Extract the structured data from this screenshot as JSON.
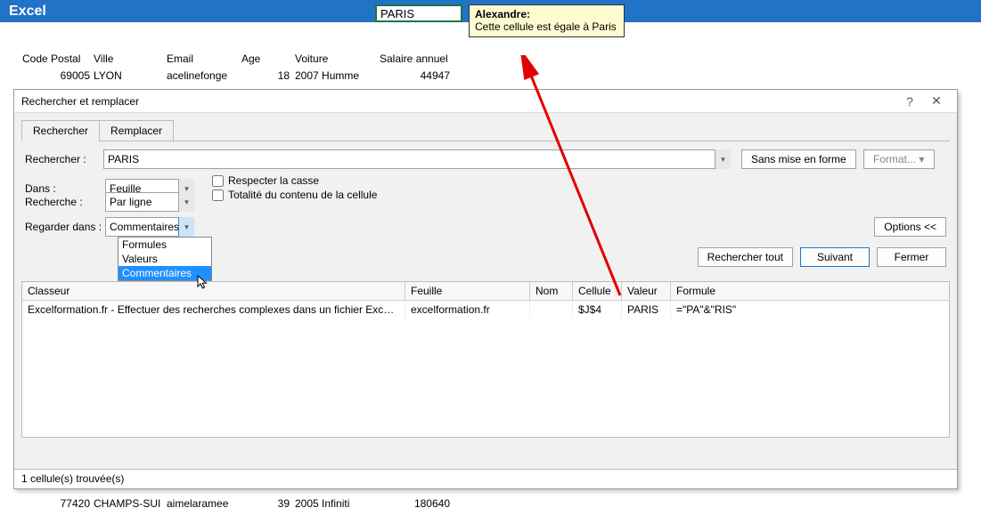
{
  "header": {
    "app": " Excel"
  },
  "cell": "PARIS",
  "comment": {
    "author": "Alexandre:",
    "text": "Cette cellule est égale à Paris"
  },
  "sheet": {
    "cols": [
      "Code Postal",
      "Ville",
      "Email",
      "Age",
      "Voiture",
      "Salaire annuel"
    ],
    "row1": {
      "cp": "69005",
      "ville": "LYON",
      "email": "acelinefonge",
      "age": "18",
      "voiture": "2007 Humme",
      "sal": "44947"
    },
    "row2": {
      "cp": "77420",
      "ville": "CHAMPS-SUI",
      "email": "aimelaramee",
      "age": "39",
      "voiture": "2005 Infiniti",
      "sal": "180640"
    }
  },
  "dialog": {
    "title": "Rechercher et remplacer",
    "tabs": [
      "Rechercher",
      "Remplacer"
    ],
    "labels": {
      "search": "Rechercher :",
      "in": "Dans :",
      "by": "Recherche :",
      "lookin": "Regarder dans :"
    },
    "searchValue": "PARIS",
    "noFormat": "Sans mise en forme",
    "format": "Format...",
    "selects": {
      "in": "Feuille",
      "by": "Par ligne",
      "lookin": "Commentaires"
    },
    "checks": {
      "casse": "Respecter la casse",
      "total": "Totalité du contenu de la cellule"
    },
    "optionsBtn": "Options <<",
    "buttons": {
      "all": "Rechercher tout",
      "next": "Suivant",
      "close": "Fermer"
    },
    "dropdown": [
      "Formules",
      "Valeurs",
      "Commentaires"
    ],
    "grid": {
      "cols": [
        "Classeur",
        "Feuille",
        "Nom",
        "Cellule",
        "Valeur",
        "Formule"
      ],
      "row": [
        "Excelformation.fr - Effectuer des recherches complexes dans un fichier Excel.xlsm",
        "excelformation.fr",
        "",
        "$J$4",
        "PARIS",
        "=\"PA\"&\"RIS\""
      ]
    },
    "status": "1 cellule(s) trouvée(s)"
  }
}
